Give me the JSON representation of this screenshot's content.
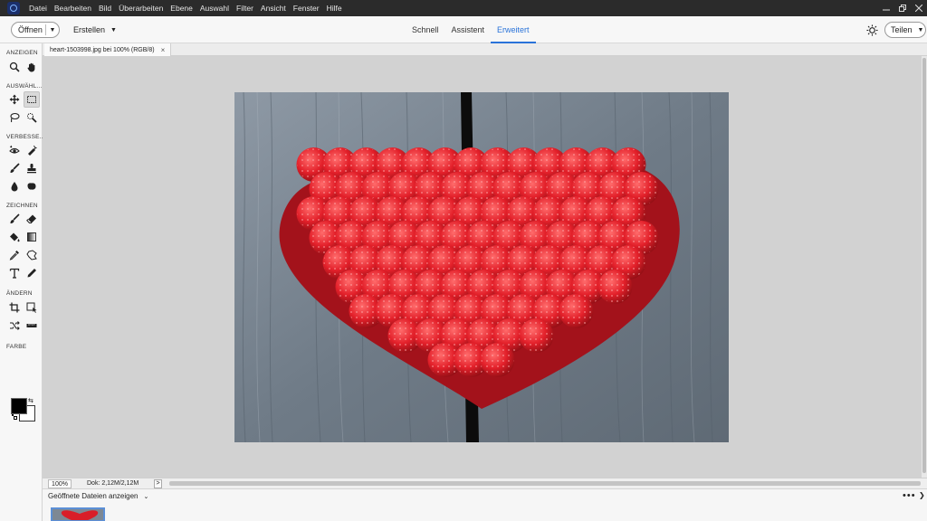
{
  "menubar": {
    "items": [
      "Datei",
      "Bearbeiten",
      "Bild",
      "Überarbeiten",
      "Ebene",
      "Auswahl",
      "Filter",
      "Ansicht",
      "Fenster",
      "Hilfe"
    ],
    "window_controls": [
      "minimize-icon",
      "restore-icon",
      "close-icon"
    ]
  },
  "topbar": {
    "open_label": "Öffnen",
    "create_label": "Erstellen",
    "modes": [
      "Schnell",
      "Assistent",
      "Erweitert"
    ],
    "active_mode": "Erweitert",
    "share_label": "Teilen"
  },
  "toolbox": {
    "sections": {
      "view": "ANZEIGEN",
      "select": "AUSWÄHL...",
      "enhance": "VERBESSE...",
      "draw": "ZEICHNEN",
      "modify": "ÄNDERN",
      "color": "FARBE"
    },
    "tools": [
      "zoom-icon",
      "hand-icon",
      "move-icon",
      "marquee-icon",
      "lasso-icon",
      "quick-select-icon",
      "red-eye-icon",
      "spot-healing-icon",
      "smart-brush-icon",
      "clone-stamp-icon",
      "blur-icon",
      "sponge-icon",
      "brush-icon",
      "eraser-icon",
      "paint-bucket-icon",
      "gradient-icon",
      "eyedropper-icon",
      "custom-shape-icon",
      "type-icon",
      "pencil-icon",
      "crop-icon",
      "recompose-icon",
      "content-aware-move-icon",
      "straighten-icon"
    ],
    "selected_tool": "marquee-icon",
    "foreground_color": "#000000",
    "background_color": "#ffffff"
  },
  "document": {
    "tab_title": "heart-1503998.jpg bei 100% (RGB/8)",
    "close_symbol": "×"
  },
  "statusbar": {
    "zoom": "100%",
    "doc_size": "Dok: 2,12M/2,12M",
    "more_symbol": ">"
  },
  "photobin": {
    "dropdown_label": "Geöffnete Dateien anzeigen",
    "more_symbol": "•••"
  },
  "colors": {
    "accent": "#2a73d9",
    "menubar_bg": "#2b2b2b",
    "canvas_bg": "#d2d2d2"
  }
}
